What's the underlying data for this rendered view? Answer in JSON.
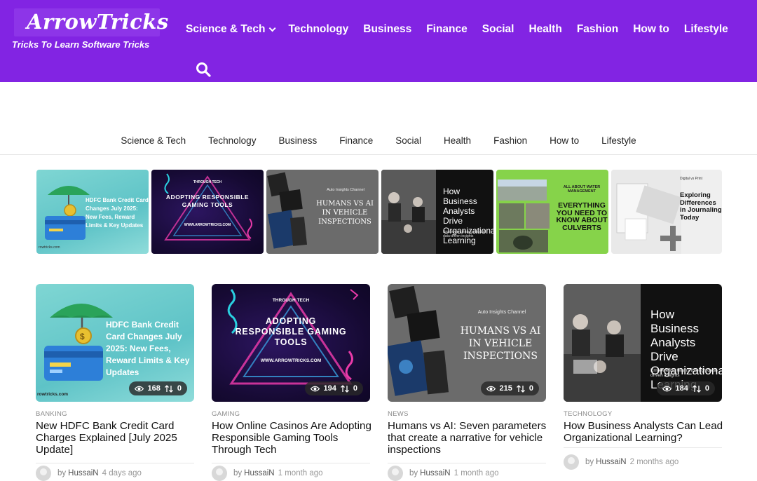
{
  "brand": {
    "logo": "ArrowTricks",
    "tagline": "Tricks To Learn Software Tricks",
    "accent": "#8224e3"
  },
  "top_nav": [
    {
      "label": "Science & Tech",
      "has_dropdown": true
    },
    {
      "label": "Technology"
    },
    {
      "label": "Business"
    },
    {
      "label": "Finance"
    },
    {
      "label": "Social"
    },
    {
      "label": "Health"
    },
    {
      "label": "Fashion"
    },
    {
      "label": "How to"
    },
    {
      "label": "Lifestyle"
    }
  ],
  "search_icon": "search-icon",
  "sub_nav": [
    "Science & Tech",
    "Technology",
    "Business",
    "Finance",
    "Social",
    "Health",
    "Fashion",
    "How to",
    "Lifestyle"
  ],
  "slider": [
    {
      "art_text": "HDFC Bank Credit Card Changes July 2025: New Fees, Reward Limits & Key Updates",
      "footer": "rowtricks.com"
    },
    {
      "art_kicker": "THROUGH TECH",
      "art_text": "ADOPTING RESPONSIBLE GAMING TOOLS",
      "url": "WWW.ARROWTRICKS.COM"
    },
    {
      "art_kicker": "Auto Insights Channel",
      "art_text": "HUMANS VS AI IN VEHICLE INSPECTIONS"
    },
    {
      "art_text": "How Business Analysts Drive Organizational Learning",
      "art_sub": "Empowering teams through data-driven insights"
    },
    {
      "art_kicker": "ALL ABOUT WATER MANAGEMENT",
      "art_text": "EVERYTHING YOU NEED TO KNOW ABOUT CULVERTS"
    },
    {
      "art_kicker": "Digital vs Print",
      "art_text": "Exploring Differences in Journaling Today"
    }
  ],
  "cards": [
    {
      "category": "BANKING",
      "title": "New HDFC Bank Credit Card Charges Explained [July 2025 Update]",
      "views": "168",
      "shares": "0",
      "by": "by",
      "author": "HussaiN",
      "time": "4 days ago",
      "art_text": "HDFC Bank Credit Card Changes July 2025: New Fees, Reward Limits & Key Updates",
      "art_footer": "rowtricks.com"
    },
    {
      "category": "GAMING",
      "title": "How Online Casinos Are Adopting Responsible Gaming Tools Through Tech",
      "views": "194",
      "shares": "0",
      "by": "by",
      "author": "HussaiN",
      "time": "1 month ago",
      "art_kicker": "THROUGH TECH",
      "art_text": "ADOPTING RESPONSIBLE GAMING TOOLS",
      "art_url": "WWW.ARROWTRICKS.COM"
    },
    {
      "category": "NEWS",
      "title": "Humans vs AI: Seven parameters that create a narrative for vehicle inspections",
      "views": "215",
      "shares": "0",
      "by": "by",
      "author": "HussaiN",
      "time": "1 month ago",
      "art_kicker": "Auto Insights Channel",
      "art_text": "HUMANS VS AI IN VEHICLE INSPECTIONS"
    },
    {
      "category": "TECHNOLOGY",
      "title": "How Business Analysts Can Lead Organizational Learning?",
      "views": "184",
      "shares": "0",
      "by": "by",
      "author": "HussaiN",
      "time": "2 months ago",
      "art_text": "How Business Analysts Drive Organizational Learning",
      "art_sub": "Empowering teams through data-driven insights"
    }
  ]
}
